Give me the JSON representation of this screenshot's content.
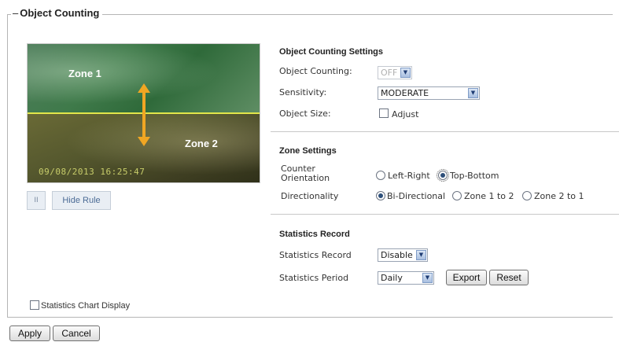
{
  "fieldset": {
    "title": "Object Counting"
  },
  "video": {
    "zone1_label": "Zone 1",
    "zone2_label": "Zone 2",
    "timestamp": "09/08/2013  16:25:47"
  },
  "controls": {
    "pause_symbol": "II",
    "hide_rule_label": "Hide Rule"
  },
  "object_counting_settings": {
    "title": "Object Counting Settings",
    "object_counting_label": "Object Counting:",
    "object_counting_value": "OFF",
    "sensitivity_label": "Sensitivity:",
    "sensitivity_value": "MODERATE",
    "object_size_label": "Object Size:",
    "adjust_label": "Adjust"
  },
  "zone_settings": {
    "title": "Zone Settings",
    "counter_orientation_label_line1": "Counter",
    "counter_orientation_label_line2": "Orientation",
    "orientation_left_right": "Left-Right",
    "orientation_top_bottom": "Top-Bottom",
    "directionality_label": "Directionality",
    "dir_bi": "Bi-Directional",
    "dir_1_to_2": "Zone 1 to 2",
    "dir_2_to_1": "Zone 2 to 1"
  },
  "statistics": {
    "title": "Statistics Record",
    "record_label": "Statistics Record",
    "record_value": "Disable",
    "period_label": "Statistics Period",
    "period_value": "Daily",
    "export_label": "Export",
    "reset_label": "Reset",
    "chart_display_label": "Statistics Chart Display"
  },
  "footer": {
    "apply_label": "Apply",
    "cancel_label": "Cancel"
  },
  "colors": {
    "zone_divider": "#e2e64a",
    "arrow": "#f0a623",
    "timestamp": "#c7cc6a"
  }
}
